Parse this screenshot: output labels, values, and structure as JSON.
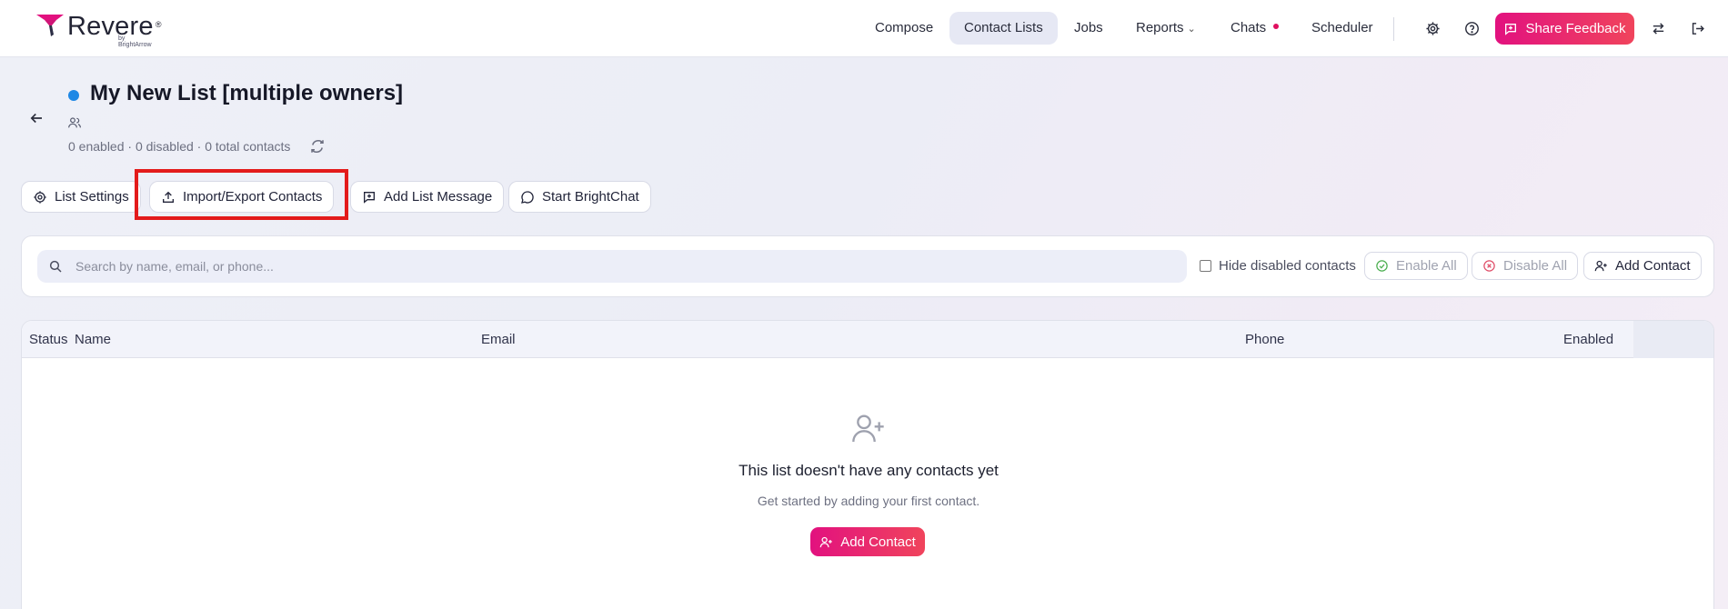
{
  "app": {
    "brand": "Revere",
    "brand_tagline": "by BrightArrow"
  },
  "nav": {
    "items": [
      {
        "label": "Compose"
      },
      {
        "label": "Contact Lists"
      },
      {
        "label": "Jobs"
      },
      {
        "label": "Reports"
      },
      {
        "label": "Chats"
      },
      {
        "label": "Scheduler"
      }
    ],
    "feedback_label": "Share Feedback"
  },
  "list": {
    "title": "My New List [multiple owners]",
    "counts": "0 enabled · 0 disabled · 0 total contacts"
  },
  "actions": {
    "list_settings": "List Settings",
    "import_export": "Import/Export Contacts",
    "add_list_message": "Add List Message",
    "start_brightchat": "Start BrightChat"
  },
  "search": {
    "placeholder": "Search by name, email, or phone...",
    "hide_disabled_label": "Hide disabled contacts",
    "enable_all": "Enable All",
    "disable_all": "Disable All",
    "add_contact": "Add Contact"
  },
  "table": {
    "columns": [
      "Status",
      "Name",
      "Email",
      "Phone",
      "Enabled"
    ]
  },
  "empty_state": {
    "title": "This list doesn't have any contacts yet",
    "subtitle": "Get started by adding your first contact.",
    "button": "Add Contact"
  },
  "colors": {
    "accent_gradient_start": "#e2117f",
    "accent_gradient_end": "#f0445c",
    "status_dot": "#1e88e5",
    "chat_dot": "#e0105f",
    "highlight": "#e31b1b"
  }
}
